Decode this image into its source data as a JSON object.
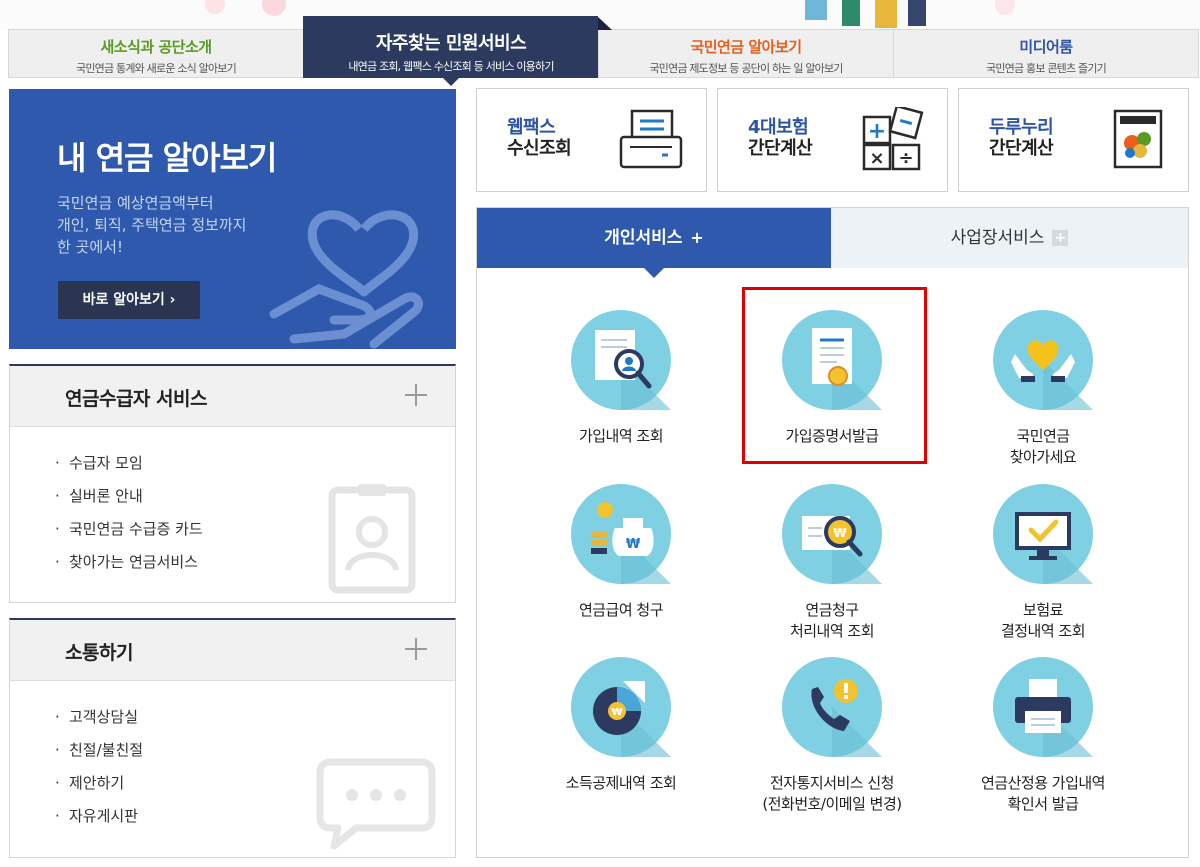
{
  "top_tabs": [
    {
      "title": "새소식과 공단소개",
      "sub": "국민연금 통계와 새로운 소식 알아보기"
    },
    {
      "title": "자주찾는 민원서비스",
      "sub": "내연금 조회, 웹팩스 수신조회 등 서비스 이용하기"
    },
    {
      "title": "국민연금 알아보기",
      "sub": "국민연금 제도정보 등 공단이 하는 일 알아보기"
    },
    {
      "title": "미디어룸",
      "sub": "국민연금 홍보 콘텐츠 즐기기"
    }
  ],
  "promo": {
    "title": "내 연금 알아보기",
    "desc": [
      "국민연금 예상연금액부터",
      "개인, 퇴직, 주택연금 정보까지",
      "한 곳에서!"
    ],
    "button": "바로 알아보기 ›"
  },
  "pension_box": {
    "title": "연금수급자 서비스",
    "items": [
      "수급자 모임",
      "실버론 안내",
      "국민연금 수급증 카드",
      "찾아가는 연금서비스"
    ]
  },
  "comm_box": {
    "title": "소통하기",
    "items": [
      "고객상담실",
      "친절/불친절",
      "제안하기",
      "자유게시판"
    ]
  },
  "quick": [
    {
      "t1": "웹팩스",
      "t2": "수신조회",
      "icon": "fax-icon"
    },
    {
      "t1": "4대보험",
      "t2": "간단계산",
      "icon": "calculator-icon"
    },
    {
      "t1": "두루누리",
      "t2": "간단계산",
      "icon": "durunuri-icon"
    }
  ],
  "svc_tabs": {
    "personal": "개인서비스",
    "business": "사업장서비스",
    "plus": "+"
  },
  "services": [
    {
      "lines": [
        "가입내역 조회"
      ],
      "icon": "document-search-icon"
    },
    {
      "lines": [
        "가입증명서발급"
      ],
      "icon": "certificate-icon"
    },
    {
      "lines": [
        "국민연금",
        "찾아가세요"
      ],
      "icon": "heart-hands-icon"
    },
    {
      "lines": [
        "연금급여 청구"
      ],
      "icon": "money-bag-icon"
    },
    {
      "lines": [
        "연금청구",
        "처리내역 조회"
      ],
      "icon": "claim-search-icon"
    },
    {
      "lines": [
        "보험료",
        "결정내역 조회"
      ],
      "icon": "monitor-check-icon"
    },
    {
      "lines": [
        "소득공제내역 조회"
      ],
      "icon": "pie-chart-icon"
    },
    {
      "lines": [
        "전자통지서비스 신청",
        "(전화번호/이메일 변경)"
      ],
      "icon": "phone-alert-icon"
    },
    {
      "lines": [
        "연금산정용 가입내역",
        "확인서 발급"
      ],
      "icon": "printer-icon"
    }
  ],
  "colors": {
    "navy": "#2b3a5e",
    "blue": "#2f59ad",
    "circle": "#7fd0e3",
    "highlight": "#e00000"
  }
}
